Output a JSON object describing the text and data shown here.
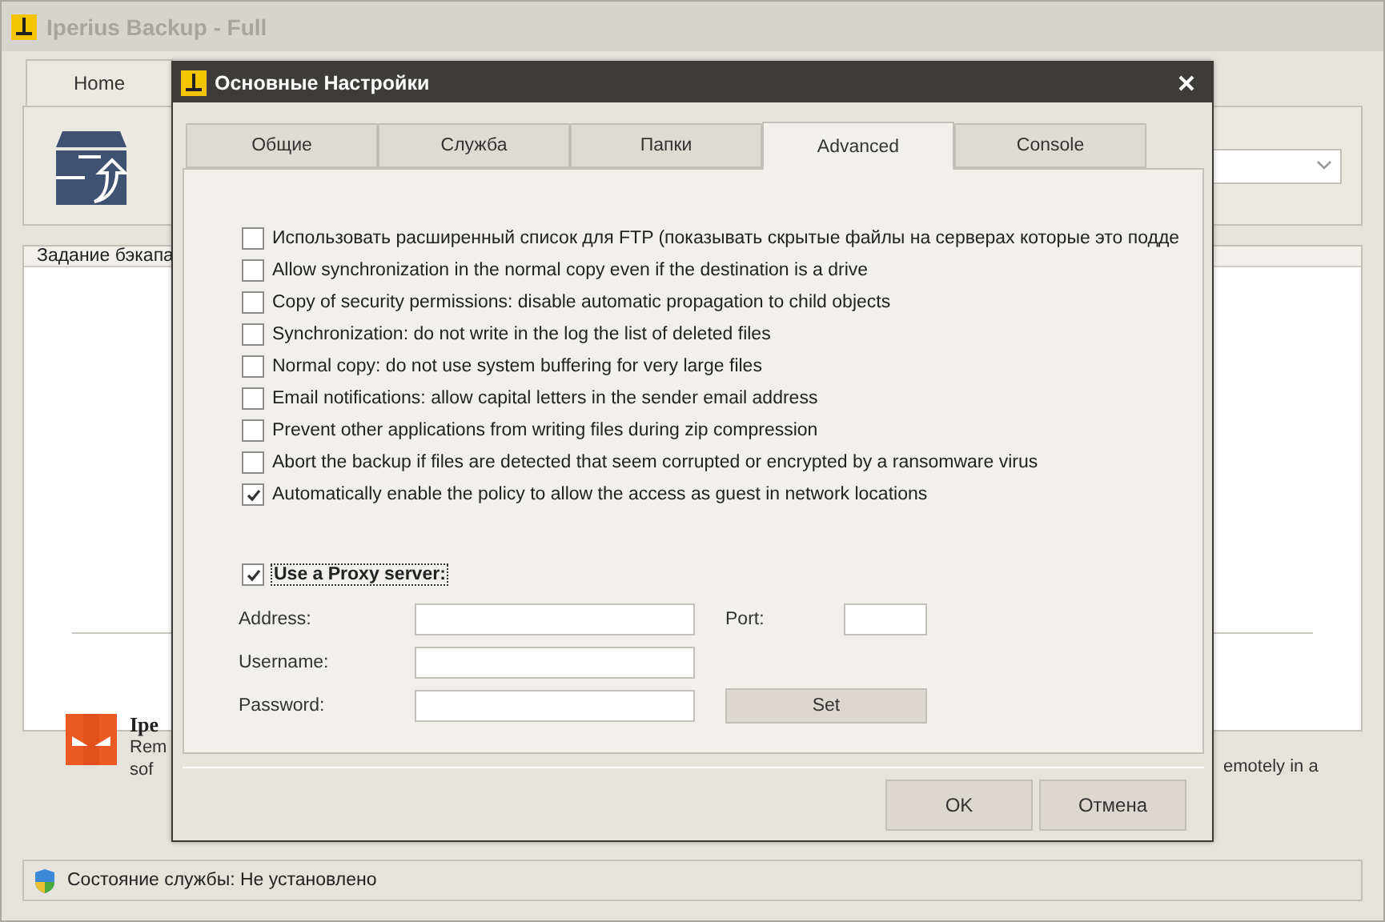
{
  "main_window": {
    "title": "Iperius Backup - Full",
    "tabs": [
      {
        "label": "Home",
        "selected": true
      }
    ],
    "job_panel": {
      "header": "Задание бэкапа"
    },
    "promo": {
      "title": "Ipe",
      "line_1": "Rem",
      "line_2": "sof",
      "line_1_right": "emotely in a"
    },
    "status_bar": "Состояние службы: Не установлено"
  },
  "dialog": {
    "title": "Основные Настройки",
    "tabs": [
      {
        "label": "Общие",
        "selected": false
      },
      {
        "label": "Служба",
        "selected": false
      },
      {
        "label": "Папки",
        "selected": false
      },
      {
        "label": "Advanced",
        "selected": true
      },
      {
        "label": "Console",
        "selected": false
      }
    ],
    "options": [
      {
        "label": "Использовать расширенный список для FTP (показывать скрытые файлы на серверах которые это подде",
        "checked": false
      },
      {
        "label": "Allow synchronization in the normal copy even if the destination is a drive",
        "checked": false
      },
      {
        "label": "Copy of security permissions: disable automatic propagation to child objects",
        "checked": false
      },
      {
        "label": "Synchronization: do not write in the log the list of deleted files",
        "checked": false
      },
      {
        "label": "Normal copy: do not use system buffering for very large files",
        "checked": false
      },
      {
        "label": "Email notifications: allow capital letters in the sender email address",
        "checked": false
      },
      {
        "label": "Prevent other applications from writing files during zip compression",
        "checked": false
      },
      {
        "label": "Abort the backup if files are detected that seem corrupted or encrypted by a ransomware virus",
        "checked": false
      },
      {
        "label": "Automatically enable the policy to allow the access as guest in network locations",
        "checked": true
      }
    ],
    "proxy": {
      "label": "Use a Proxy server:",
      "checked": true,
      "address_label": "Address:",
      "port_label": "Port:",
      "username_label": "Username:",
      "password_label": "Password:",
      "set_button": "Set"
    },
    "buttons": [
      "OK",
      "Отмена"
    ]
  }
}
